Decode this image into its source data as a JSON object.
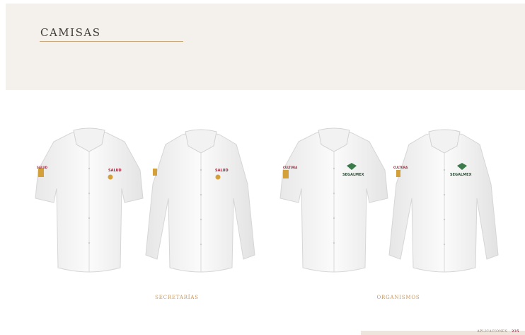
{
  "header": {
    "title": "CAMISAS"
  },
  "groups": [
    {
      "caption": "SECRETARÍAS",
      "logo": "SALUD",
      "sleeve": "SALUD"
    },
    {
      "caption": "ORGANISMOS",
      "logo": "SEGALMEX",
      "sleeve": "CULTURA"
    }
  ],
  "footer": {
    "section": "APLICACIONES",
    "page": "235"
  },
  "colors": {
    "accent": "#c8955a",
    "brand": "#a4243b",
    "header_bg": "#f4f0eb",
    "segalmex_green": "#3b7a4a"
  }
}
